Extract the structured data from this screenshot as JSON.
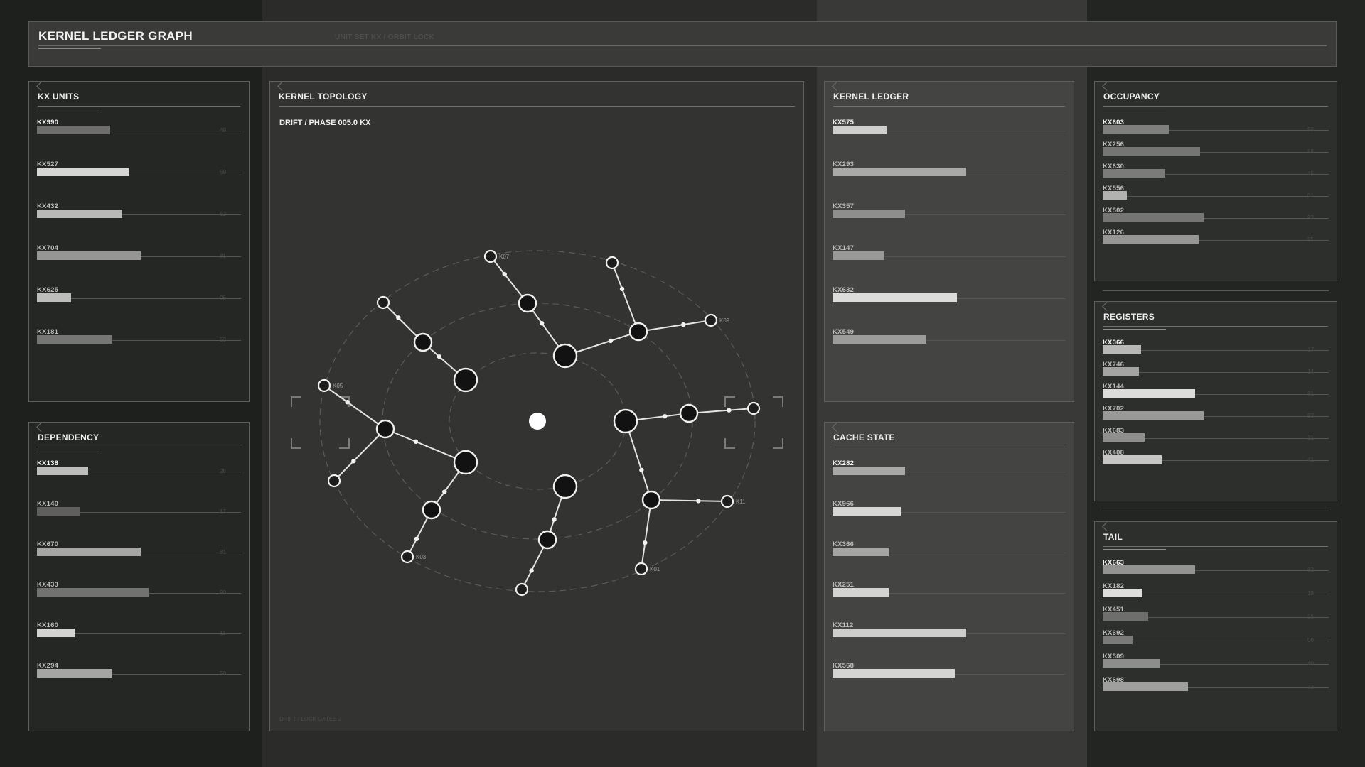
{
  "header": {
    "title": "KERNEL LEDGER GRAPH",
    "subtitle": "UNIT SET KX / ORBIT LOCK"
  },
  "panels": {
    "kx_units": {
      "title": "KX UNITS",
      "rows": [
        {
          "label": "KX990",
          "value": "49",
          "fill": 0.43,
          "color": "#6e6f6d"
        },
        {
          "label": "KX527",
          "value": "69",
          "fill": 0.54,
          "color": "#d6d6d4"
        },
        {
          "label": "KX432",
          "value": "62",
          "fill": 0.5,
          "color": "#b9bab8"
        },
        {
          "label": "KX704",
          "value": "81",
          "fill": 0.61,
          "color": "#969795"
        },
        {
          "label": "KX625",
          "value": "06",
          "fill": 0.2,
          "color": "#bdbebc"
        },
        {
          "label": "KX181",
          "value": "50",
          "fill": 0.44,
          "color": "#767775"
        }
      ]
    },
    "dependency": {
      "title": "DEPENDENCY",
      "rows": [
        {
          "label": "KX138",
          "value": "28",
          "fill": 0.3,
          "color": "#bebfbd"
        },
        {
          "label": "KX140",
          "value": "17",
          "fill": 0.25,
          "color": "#5f605e"
        },
        {
          "label": "KX670",
          "value": "81",
          "fill": 0.61,
          "color": "#a6a7a5"
        },
        {
          "label": "KX433",
          "value": "90",
          "fill": 0.66,
          "color": "#727371"
        },
        {
          "label": "KX160",
          "value": "11",
          "fill": 0.22,
          "color": "#d3d3d1"
        },
        {
          "label": "KX294",
          "value": "50",
          "fill": 0.44,
          "color": "#a5a6a4"
        }
      ]
    },
    "topology": {
      "title": "KERNEL TOPOLOGY",
      "subtitle": "DRIFT / PHASE 005.0 KX",
      "footer": "DRIFT / LOCK GATES 2",
      "node_labels": [
        "K07",
        "K09",
        "K05",
        "K11",
        "K03",
        "K01"
      ]
    },
    "ledger": {
      "title": "KERNEL LEDGER",
      "rows": [
        {
          "label": "KX575",
          "fill": 0.23,
          "color": "#cfcfcd"
        },
        {
          "label": "KX293",
          "fill": 0.57,
          "color": "#a9aaa8"
        },
        {
          "label": "KX357",
          "fill": 0.31,
          "color": "#8e8f8d"
        },
        {
          "label": "KX147",
          "fill": 0.22,
          "color": "#9a9b99"
        },
        {
          "label": "KX632",
          "fill": 0.53,
          "color": "#dcdcda"
        },
        {
          "label": "KX549",
          "fill": 0.4,
          "color": "#9c9d9b"
        }
      ]
    },
    "cache": {
      "title": "CACHE STATE",
      "rows": [
        {
          "label": "KX282",
          "fill": 0.31,
          "color": "#a8a9a7"
        },
        {
          "label": "KX966",
          "fill": 0.29,
          "color": "#d7d7d5"
        },
        {
          "label": "KX366",
          "fill": 0.24,
          "color": "#a5a6a4"
        },
        {
          "label": "KX251",
          "fill": 0.24,
          "color": "#d3d3d1"
        },
        {
          "label": "KX112",
          "fill": 0.57,
          "color": "#cececc"
        },
        {
          "label": "KX568",
          "fill": 0.52,
          "color": "#d4d4d2"
        }
      ]
    },
    "occupancy": {
      "title": "OCCUPANCY",
      "rows": [
        {
          "label": "KX603",
          "value": "58",
          "fill": 0.38,
          "color": "#7f807e"
        },
        {
          "label": "KX256",
          "value": "88",
          "fill": 0.56,
          "color": "#757674"
        },
        {
          "label": "KX630",
          "value": "45",
          "fill": 0.36,
          "color": "#7b7c7a"
        },
        {
          "label": "KX556",
          "value": "01",
          "fill": 0.14,
          "color": "#b2b3b1"
        },
        {
          "label": "KX502",
          "value": "93",
          "fill": 0.58,
          "color": "#757674"
        },
        {
          "label": "KX126",
          "value": "85",
          "fill": 0.55,
          "color": "#969795"
        }
      ]
    },
    "registers": {
      "title": "REGISTERS",
      "rows": [
        {
          "label": "KX366",
          "value": "17",
          "fill": 0.22,
          "color": "#b8b9b7"
        },
        {
          "label": "KX746",
          "value": "14",
          "fill": 0.21,
          "color": "#a4a5a3"
        },
        {
          "label": "KX144",
          "value": "81",
          "fill": 0.53,
          "color": "#dcdcda"
        },
        {
          "label": "KX702",
          "value": "92",
          "fill": 0.58,
          "color": "#999a98"
        },
        {
          "label": "KX683",
          "value": "21",
          "fill": 0.24,
          "color": "#8f908e"
        },
        {
          "label": "KX408",
          "value": "41",
          "fill": 0.34,
          "color": "#c6c6c4"
        }
      ]
    },
    "tail": {
      "title": "TAIL",
      "rows": [
        {
          "label": "KX663",
          "value": "82",
          "fill": 0.53,
          "color": "#939492"
        },
        {
          "label": "KX182",
          "value": "19",
          "fill": 0.23,
          "color": "#dededc"
        },
        {
          "label": "KX451",
          "value": "26",
          "fill": 0.26,
          "color": "#6e6f6d"
        },
        {
          "label": "KX692",
          "value": "00",
          "fill": 0.17,
          "color": "#7a7b79"
        },
        {
          "label": "KX509",
          "value": "40",
          "fill": 0.33,
          "color": "#8d8e8c"
        },
        {
          "label": "KX698",
          "value": "73",
          "fill": 0.49,
          "color": "#9fa09e"
        }
      ]
    }
  }
}
